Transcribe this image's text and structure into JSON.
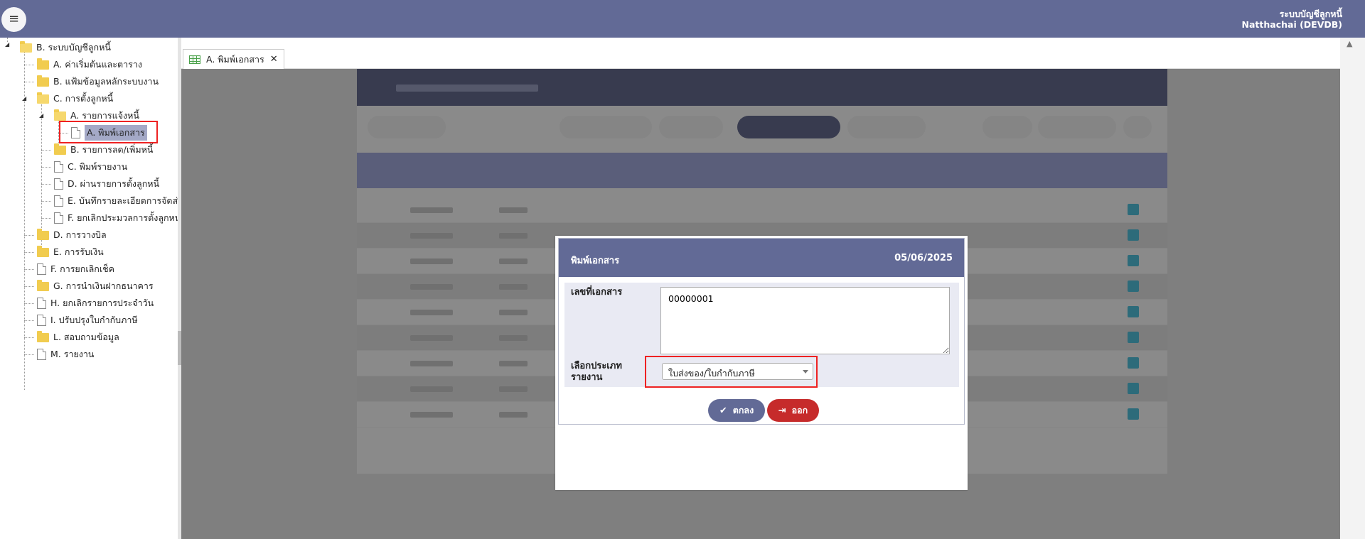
{
  "header": {
    "system_name": "ระบบบัญชีลูกหนี้",
    "user": "Natthachai (DEVDB)",
    "menu_icon": "hamburger-icon"
  },
  "sidebar": {
    "items": [
      {
        "label": "B. ระบบบัญชีลูกหนี้",
        "icon": "folder-open-icon"
      },
      {
        "label": "A. ค่าเริ่มต้นและตาราง",
        "icon": "folder-icon"
      },
      {
        "label": "B. แฟ้มข้อมูลหลักระบบงาน",
        "icon": "folder-icon"
      },
      {
        "label": "C. การตั้งลูกหนี้",
        "icon": "folder-open-icon"
      },
      {
        "label": "A. รายการแจ้งหนี้",
        "icon": "folder-open-icon"
      },
      {
        "label": "A. พิมพ์เอกสาร",
        "icon": "document-icon"
      },
      {
        "label": "B. รายการลด/เพิ่มหนี้",
        "icon": "folder-icon"
      },
      {
        "label": "C. พิมพ์รายงาน",
        "icon": "document-icon"
      },
      {
        "label": "D. ผ่านรายการตั้งลูกหนี้",
        "icon": "document-icon"
      },
      {
        "label": "E. บันทึกรายละเอียดการจัดส่",
        "icon": "document-icon"
      },
      {
        "label": "F. ยกเลิกประมวลการตั้งลูกหน่",
        "icon": "document-icon"
      },
      {
        "label": "D. การวางบิล",
        "icon": "folder-icon"
      },
      {
        "label": "E. การรับเงิน",
        "icon": "folder-icon"
      },
      {
        "label": "F. การยกเลิกเช็ค",
        "icon": "document-icon"
      },
      {
        "label": "G. การนำเงินฝากธนาคาร",
        "icon": "folder-icon"
      },
      {
        "label": "H. ยกเลิกรายการประจำวัน",
        "icon": "document-icon"
      },
      {
        "label": "I. ปรับปรุงใบกำกับภาษี",
        "icon": "document-icon"
      },
      {
        "label": "L. สอบถามข้อมูล",
        "icon": "folder-icon"
      },
      {
        "label": "M. รายงาน",
        "icon": "document-icon"
      }
    ]
  },
  "tabs": [
    {
      "label": "A. พิมพ์เอกสาร",
      "icon": "grid-icon",
      "close": "✕"
    }
  ],
  "dialog": {
    "title": "พิมพ์เอกสาร",
    "date": "05/06/2025",
    "doc_no_label": "เลขที่เอกสาร",
    "doc_no_value": "00000001",
    "report_type_label_line1": "เลือกประเภท",
    "report_type_label_line2": "รายงาน",
    "report_type_value": "ใบส่งของ/ใบกำกับภาษี",
    "ok_label": "ตกลง",
    "exit_label": "ออก"
  },
  "colors": {
    "header_bg": "#626a96",
    "exit_button": "#c62b2b",
    "highlight": "#e22222"
  }
}
